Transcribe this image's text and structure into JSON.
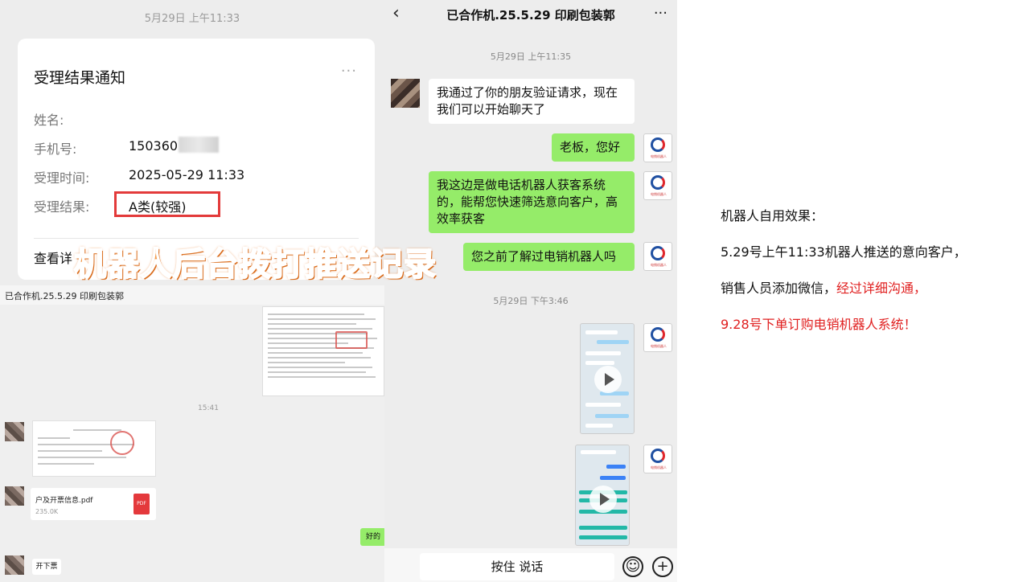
{
  "notification": {
    "time": "5月29日 上午11:33",
    "title": "受理结果通知",
    "more_icon": "···",
    "name_label": "姓名:",
    "name_value": "",
    "phone_label": "手机号:",
    "phone_value": "150360",
    "accept_time_label": "受理时间:",
    "accept_time_value": "2025-05-29 11:33",
    "result_label": "受理结果:",
    "result_value": "A类(较强)",
    "detail_link": "查看详"
  },
  "overlay_caption": "机器人后台拨打推送记录",
  "group_chat": {
    "title": "已合作机.25.5.29 印刷包装郭",
    "more_icon": "···",
    "timestamp": "15:41",
    "file_name": "户及开票信息.pdf",
    "file_size": "235.0K",
    "file_icon": "PDF",
    "reply_text": "好的",
    "last_message": "开下票"
  },
  "chat": {
    "title": "已合作机.25.5.29 印刷包装郭",
    "back_icon": "‹",
    "more_icon": "···",
    "time1": "5月29日 上午11:35",
    "msg1": "我通过了你的朋友验证请求，现在我们可以开始聊天了",
    "msg2": "老板，您好",
    "msg3": "我这边是做电话机器人获客系统的，能帮您快速筛选意向客户，高效率获客",
    "msg4": "您之前了解过电销机器人吗",
    "time2": "5月29日 下午3:46",
    "voice_button": "按住 说话",
    "emoji_icon": "☺",
    "plus_icon": "+"
  },
  "notes": {
    "line1": "机器人自用效果：",
    "line2": "5.29号上午11:33机器人推送的意向客户，",
    "line3a": "销售人员添加微信，",
    "line3b": "经过详细沟通，",
    "line4": "9.28号下单订购电销机器人系统！"
  },
  "colors": {
    "chat_bg": "#ededed",
    "green_bubble": "#95ec69",
    "highlight_border": "#e33a3a",
    "overlay_text": "#f39a4a",
    "emphasis_red": "#e02020"
  }
}
